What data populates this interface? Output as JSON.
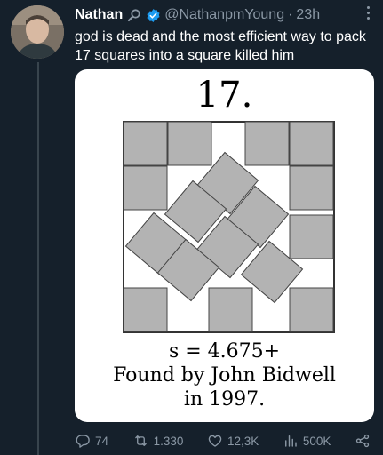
{
  "tweet": {
    "author_name": "Nathan",
    "handle": "@NathanpmYoung",
    "separator": "·",
    "time": "23h",
    "text": "god is dead and the most efficient way to pack 17 squares into a square killed him",
    "badges": [
      "magnifier-icon",
      "verified-badge-icon"
    ]
  },
  "media": {
    "title": "17.",
    "caption_line1": "s = 4.675+",
    "caption_line2": "Found by John Bidwell",
    "caption_line3": "in 1997."
  },
  "actions": {
    "replies": "74",
    "retweets": "1.330",
    "likes": "12,3K",
    "views": "500K"
  },
  "colors": {
    "background": "#15202b",
    "muted_text": "#8b98a5",
    "verified_blue": "#1d9bf0",
    "square_fill": "#b3b3b3"
  }
}
